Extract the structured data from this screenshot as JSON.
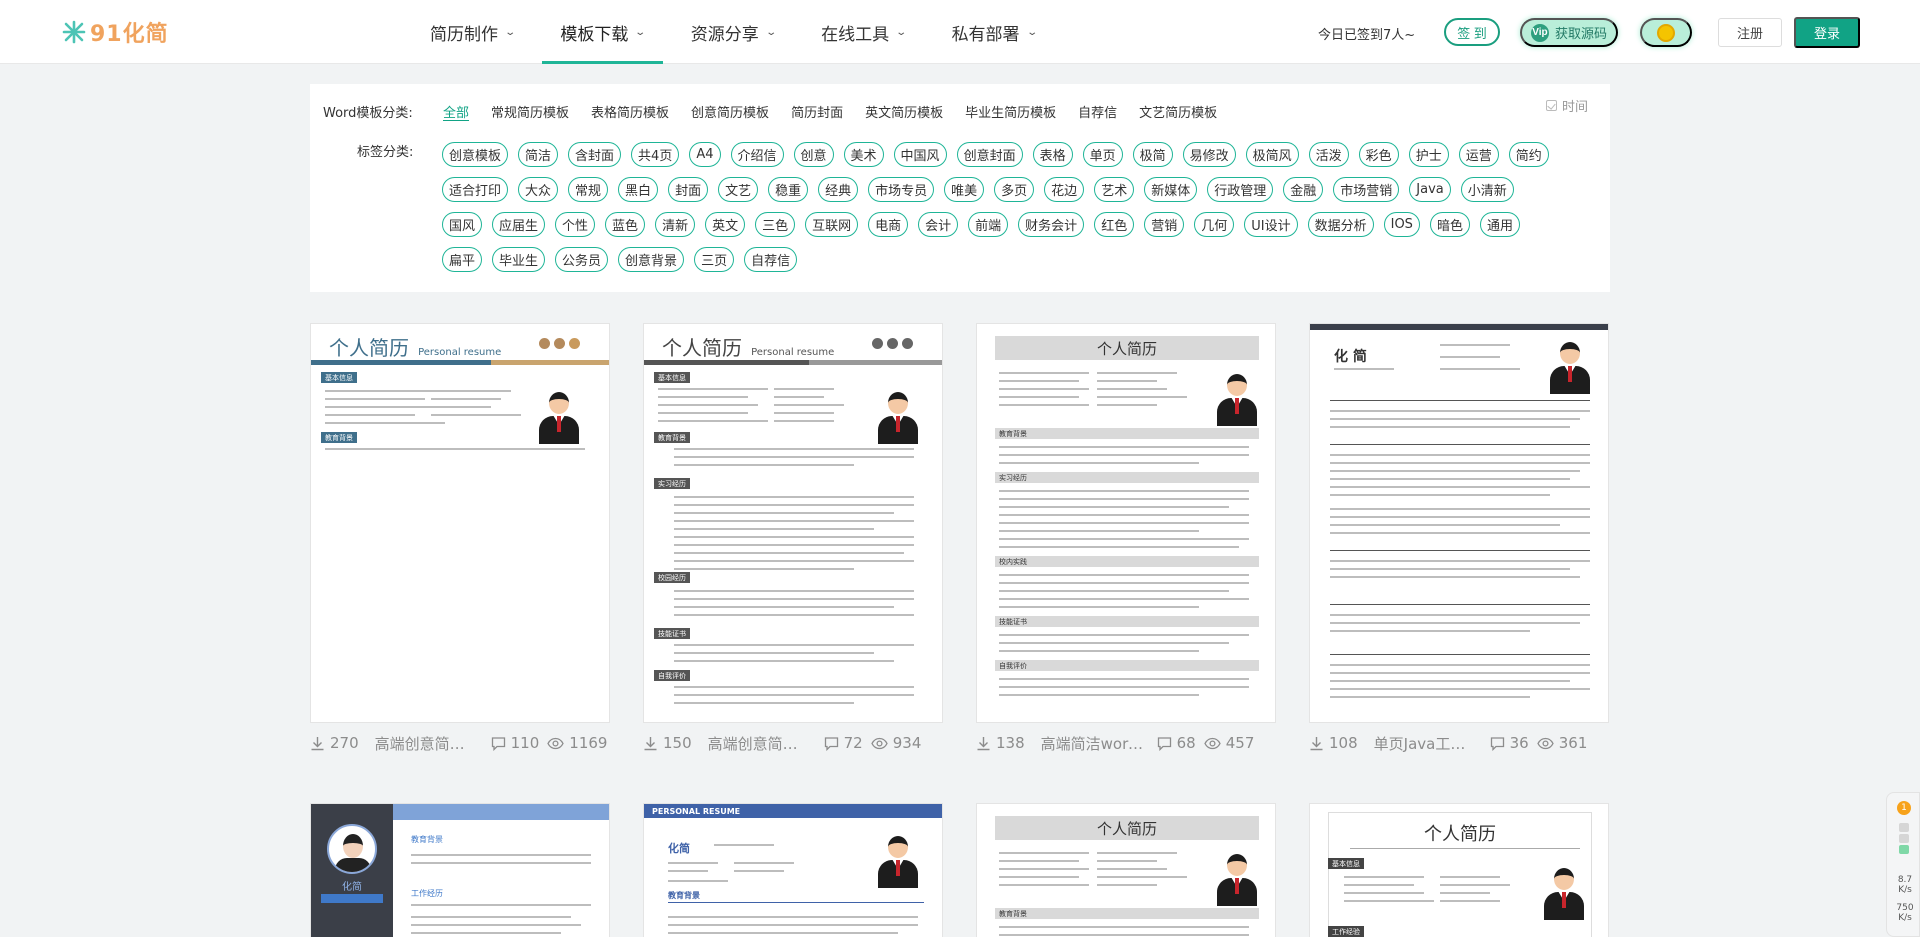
{
  "logo": {
    "text": "91化简"
  },
  "nav": [
    {
      "label": "简历制作",
      "active": false
    },
    {
      "label": "模板下载",
      "active": true
    },
    {
      "label": "资源分享",
      "active": false
    },
    {
      "label": "在线工具",
      "active": false
    },
    {
      "label": "私有部署",
      "active": false
    }
  ],
  "header": {
    "checkin_text": "今日已签到7人~",
    "sign_label": "签 到",
    "vip_label": "获取源码",
    "vip_badge": "Vip",
    "register_label": "注册",
    "login_label": "登录"
  },
  "filter": {
    "word_label": "Word模板分类:",
    "word_categories": [
      "全部",
      "常规简历模板",
      "表格简历模板",
      "创意简历模板",
      "简历封面",
      "英文简历模板",
      "毕业生简历模板",
      "自荐信",
      "文艺简历模板"
    ],
    "active_category": "全部",
    "sort_label": "时间",
    "tag_label": "标签分类:",
    "tags": [
      "创意模板",
      "简洁",
      "含封面",
      "共4页",
      "A4",
      "介绍信",
      "创意",
      "美术",
      "中国风",
      "创意封面",
      "表格",
      "单页",
      "极简",
      "易修改",
      "极简风",
      "活泼",
      "彩色",
      "护士",
      "运营",
      "简约",
      "适合打印",
      "大众",
      "常规",
      "黑白",
      "封面",
      "文艺",
      "稳重",
      "经典",
      "市场专员",
      "唯美",
      "多页",
      "花边",
      "艺术",
      "新媒体",
      "行政管理",
      "金融",
      "市场营销",
      "Java",
      "小清新",
      "国风",
      "应届生",
      "个性",
      "蓝色",
      "清新",
      "英文",
      "三色",
      "互联网",
      "电商",
      "会计",
      "前端",
      "财务会计",
      "红色",
      "营销",
      "几何",
      "UI设计",
      "数据分析",
      "IOS",
      "暗色",
      "通用",
      "扁平",
      "毕业生",
      "公务员",
      "创意背景",
      "三页",
      "自荐信"
    ]
  },
  "cards": [
    {
      "downloads": "270",
      "title": "高端创意简历模板",
      "comments": "110",
      "views": "1169",
      "preview_title": "个人简历",
      "preview_sub": "Personal resume"
    },
    {
      "downloads": "150",
      "title": "高端创意简历模板",
      "comments": "72",
      "views": "934",
      "preview_title": "个人简历",
      "preview_sub": "Personal resume"
    },
    {
      "downloads": "138",
      "title": "高端简洁word简历模板",
      "comments": "68",
      "views": "457",
      "preview_title": "个人简历"
    },
    {
      "downloads": "108",
      "title": "单页Java工程师简历模板",
      "comments": "36",
      "views": "361",
      "preview_title": "化 简"
    },
    {
      "preview_title": "化简",
      "preview_sub": "教育背景"
    },
    {
      "preview_title": "PERSONAL RESUME",
      "preview_sub": "化简"
    },
    {
      "preview_title": "个人简历"
    },
    {
      "preview_title": "个人简历",
      "preview_sub": "基本信息"
    }
  ],
  "side_widget": {
    "badge": "1",
    "speed_up": "8.7",
    "unit_up": "K/s",
    "speed_down": "750",
    "unit_down": "K/s"
  },
  "colors": {
    "accent": "#11a385",
    "tag_border": "#1fb597",
    "logo": "#f0a35e"
  }
}
